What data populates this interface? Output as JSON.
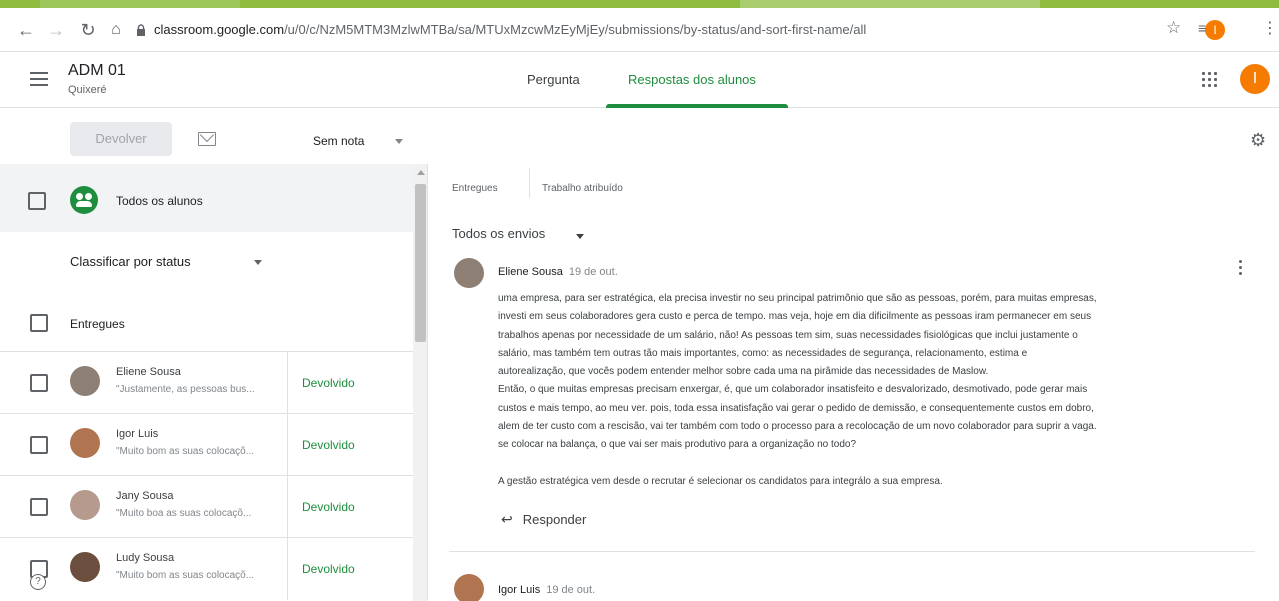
{
  "browser": {
    "url_host": "classroom.google.com",
    "url_path": "/u/0/c/NzM5MTM3MzlwMTBa/sa/MTUxMzcwMzEyMjEy/submissions/by-status/and-sort-first-name/all",
    "profile_initial": "I"
  },
  "header": {
    "class_name": "ADM 01",
    "class_section": "Quixeré",
    "tabs": [
      {
        "label": "Pergunta"
      },
      {
        "label": "Respostas dos alunos"
      }
    ],
    "avatar_initial": "I"
  },
  "toolbar": {
    "return_label": "Devolver",
    "grade_select": "Sem nota"
  },
  "left": {
    "all_students_label": "Todos os alunos",
    "sort_label": "Classificar por status",
    "section_label": "Entregues",
    "students": [
      {
        "name": "Eliene Sousa",
        "preview": "\"Justamente, as pessoas bus...",
        "status": "Devolvido",
        "color": "#8d7f74"
      },
      {
        "name": "Igor Luis",
        "preview": "\"Muito bom as suas colocaçõ...",
        "status": "Devolvido",
        "color": "#b07450"
      },
      {
        "name": "Jany Sousa",
        "preview": "\"Muito boa as suas colocaçõ...",
        "status": "Devolvido",
        "color": "#b59a8d"
      },
      {
        "name": "Ludy Sousa",
        "preview": "\"Muito bom as suas colocaçõ...",
        "status": "Devolvido",
        "color": "#6b4e3d"
      }
    ]
  },
  "right": {
    "stats": [
      {
        "label": "Entregues"
      },
      {
        "label": "Trabalho atribuído"
      }
    ],
    "filter_label": "Todos os envios",
    "submissions": [
      {
        "name": "Eliene Sousa",
        "date": "19 de out.",
        "color": "#8d7f74",
        "lines": [
          "uma empresa, para ser estratégica,  ela precisa investir no seu principal patrimônio que são as pessoas, porém, para muitas empresas,",
          "investi em seus colaboradores gera custo e perca de tempo. mas veja, hoje em dia dificilmente as pessoas iram permanecer em seus",
          "trabalhos apenas por necessidade de um salário, não! As pessoas tem  sim, suas necessidades fisiológicas que inclui justamente o",
          "salário,  mas também tem outras tão mais importantes, como: as necessidades de segurança, relacionamento, estima e",
          "autorealização, que vocês podem entender melhor sobre cada uma na pirâmide das necessidades de Maslow.",
          " Então, o que muitas empresas precisam enxergar, é,  que um colaborador insatisfeito e desvalorizado, desmotivado, pode gerar mais",
          "custos e mais tempo, ao meu ver. pois, toda essa insatisfação vai gerar o pedido de demissão, e  consequentemente custos em dobro,",
          "alem  de ter custo com a rescisão, vai ter também com todo o processo para a recolocação de um novo colaborador para suprir a vaga.",
          "se colocar na balança, o que vai ser mais produtivo para a organização no todo?",
          "",
          "A gestão estratégica vem desde o recrutar é selecionar os candidatos para integrálo a sua empresa."
        ],
        "reply_label": "Responder"
      },
      {
        "name": "Igor Luis",
        "date": "19 de out.",
        "color": "#b07450"
      }
    ]
  }
}
